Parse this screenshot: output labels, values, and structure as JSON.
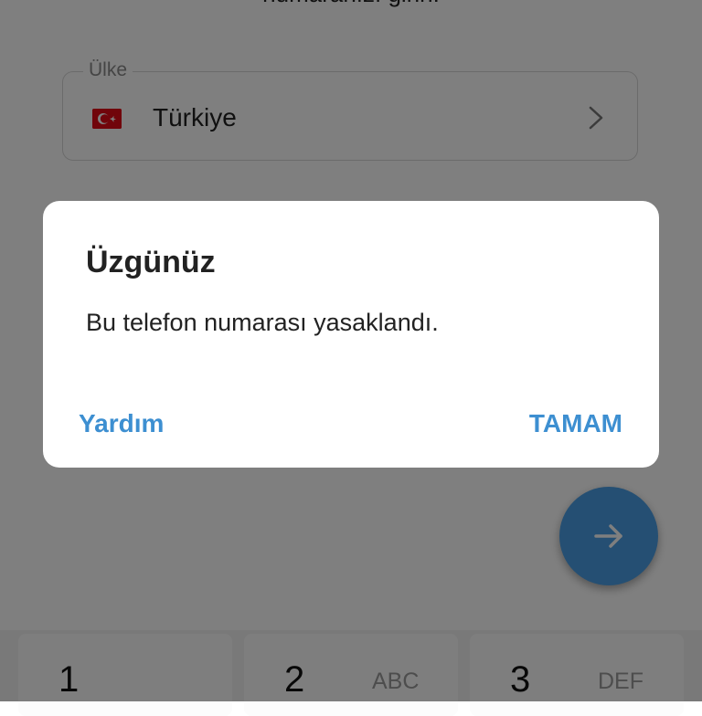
{
  "page": {
    "subtitle": "numaranızı girin."
  },
  "country": {
    "label": "Ülke",
    "value": "Türkiye",
    "flag_icon": "turkey-flag-icon"
  },
  "keypad": {
    "keys": [
      {
        "digit": "1",
        "letters": ""
      },
      {
        "digit": "2",
        "letters": "ABC"
      },
      {
        "digit": "3",
        "letters": "DEF"
      }
    ]
  },
  "dialog": {
    "title": "Üzgünüz",
    "message": "Bu telefon numarası yasaklandı.",
    "help_button": "Yardım",
    "ok_button": "TAMAM"
  },
  "colors": {
    "accent": "#3d8fd1",
    "fab": "#4a9fe6",
    "scrim": "rgba(0,0,0,0.5)"
  }
}
